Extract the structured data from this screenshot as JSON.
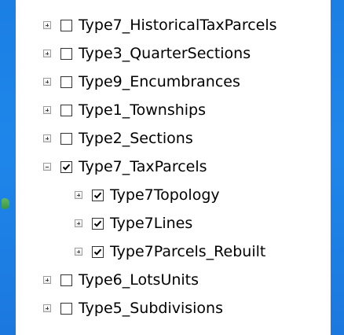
{
  "layer_tree": {
    "items": [
      {
        "label": "Type7_HistoricalTaxParcels",
        "expanded": false,
        "checked": false,
        "level": 0,
        "icon": "plus-expander"
      },
      {
        "label": "Type3_QuarterSections",
        "expanded": false,
        "checked": false,
        "level": 0,
        "icon": "plus-expander"
      },
      {
        "label": "Type9_Encumbrances",
        "expanded": false,
        "checked": false,
        "level": 0,
        "icon": "plus-expander"
      },
      {
        "label": "Type1_Townships",
        "expanded": false,
        "checked": false,
        "level": 0,
        "icon": "plus-expander"
      },
      {
        "label": "Type2_Sections",
        "expanded": false,
        "checked": false,
        "level": 0,
        "icon": "plus-expander"
      },
      {
        "label": "Type7_TaxParcels",
        "expanded": true,
        "checked": true,
        "level": 0,
        "icon": "minus-expander"
      },
      {
        "label": "Type7Topology",
        "expanded": false,
        "checked": true,
        "level": 1,
        "icon": "plus-expander"
      },
      {
        "label": "Type7Lines",
        "expanded": false,
        "checked": true,
        "level": 1,
        "icon": "plus-expander"
      },
      {
        "label": "Type7Parcels_Rebuilt",
        "expanded": false,
        "checked": true,
        "level": 1,
        "icon": "plus-expander"
      },
      {
        "label": "Type6_LotsUnits",
        "expanded": false,
        "checked": false,
        "level": 0,
        "icon": "plus-expander"
      },
      {
        "label": "Type5_Subdivisions",
        "expanded": false,
        "checked": false,
        "level": 0,
        "icon": "plus-expander"
      }
    ]
  },
  "colors": {
    "background": "#1f84e6",
    "panel": "#ffffff",
    "text": "#000000"
  }
}
